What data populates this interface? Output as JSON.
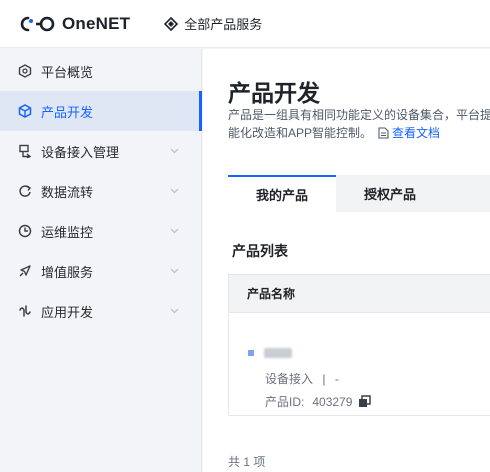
{
  "header": {
    "logo_text": "OneNET",
    "all_services_label": "全部产品服务"
  },
  "sidebar": {
    "items": [
      {
        "label": "平台概览",
        "icon": "hexagon-icon",
        "has_chevron": false,
        "active": false
      },
      {
        "label": "产品开发",
        "icon": "cube-icon",
        "has_chevron": false,
        "active": true
      },
      {
        "label": "设备接入管理",
        "icon": "device-icon",
        "has_chevron": true,
        "active": false
      },
      {
        "label": "数据流转",
        "icon": "flow-icon",
        "has_chevron": true,
        "active": false
      },
      {
        "label": "运维监控",
        "icon": "monitor-icon",
        "has_chevron": true,
        "active": false
      },
      {
        "label": "增值服务",
        "icon": "rocket-icon",
        "has_chevron": true,
        "active": false
      },
      {
        "label": "应用开发",
        "icon": "app-icon",
        "has_chevron": true,
        "active": false
      }
    ]
  },
  "main": {
    "title": "产品开发",
    "description_line1": "产品是一组具有相同功能定义的设备集合，平台提",
    "description_line2": "能化改造和APP智能控制。",
    "doc_link": "查看文档",
    "tabs": [
      {
        "label": "我的产品",
        "active": true
      },
      {
        "label": "授权产品",
        "active": false
      }
    ],
    "list_title": "产品列表",
    "table": {
      "column_header": "产品名称",
      "rows": [
        {
          "access_label": "设备接入",
          "separator": "|",
          "access_value": "-",
          "id_label": "产品ID:",
          "id_value": "403279"
        }
      ]
    },
    "total_text": "共 1 项"
  },
  "colors": {
    "accent": "#1664ff",
    "active_bg": "#dfe7f5",
    "sidebar_bg": "#f3f4f7"
  }
}
